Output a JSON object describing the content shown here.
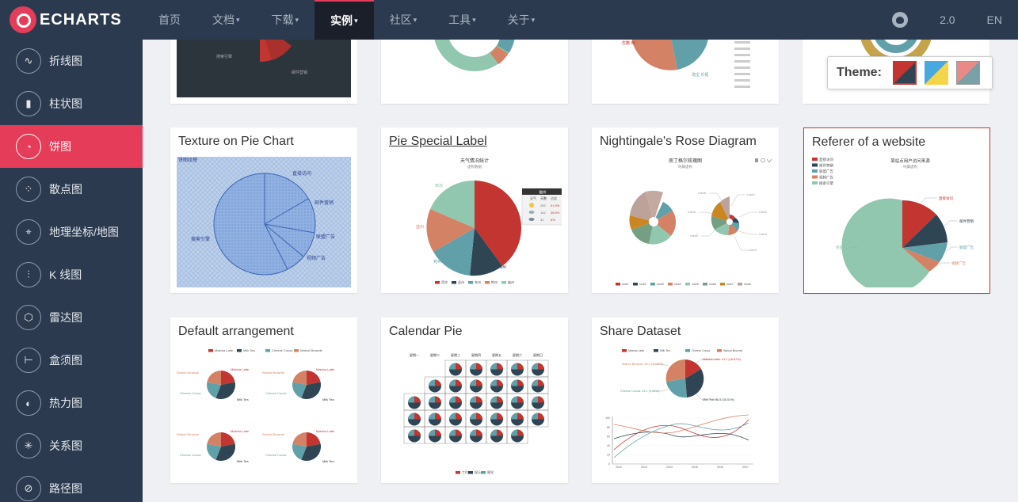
{
  "brand": {
    "name": "ECHARTS"
  },
  "nav": {
    "items": [
      {
        "label": "首页",
        "caret": false,
        "active": false
      },
      {
        "label": "文档",
        "caret": true,
        "active": false
      },
      {
        "label": "下载",
        "caret": true,
        "active": false
      },
      {
        "label": "实例",
        "caret": true,
        "active": true
      },
      {
        "label": "社区",
        "caret": true,
        "active": false
      },
      {
        "label": "工具",
        "caret": true,
        "active": false
      },
      {
        "label": "关于",
        "caret": true,
        "active": false
      }
    ],
    "version": "2.0",
    "language": "EN",
    "github_icon": "github-icon"
  },
  "sidebar": {
    "items": [
      {
        "label": "折线图",
        "icon": "line-chart-icon",
        "glyph": "∿"
      },
      {
        "label": "柱状图",
        "icon": "bar-chart-icon",
        "glyph": "▮"
      },
      {
        "label": "饼图",
        "icon": "pie-chart-icon",
        "glyph": "◔",
        "active": true
      },
      {
        "label": "散点图",
        "icon": "scatter-chart-icon",
        "glyph": "⁘"
      },
      {
        "label": "地理坐标/地图",
        "icon": "map-icon",
        "glyph": "⌖"
      },
      {
        "label": "K 线图",
        "icon": "candlestick-icon",
        "glyph": "⫶"
      },
      {
        "label": "雷达图",
        "icon": "radar-icon",
        "glyph": "⬡"
      },
      {
        "label": "盒须图",
        "icon": "boxplot-icon",
        "glyph": "⊢"
      },
      {
        "label": "热力图",
        "icon": "heatmap-icon",
        "glyph": "◐"
      },
      {
        "label": "关系图",
        "icon": "graph-icon",
        "glyph": "✳"
      },
      {
        "label": "路径图",
        "icon": "path-icon",
        "glyph": "⊘"
      }
    ]
  },
  "theme": {
    "label": "Theme:",
    "colors": [
      "#c23531",
      "#2f4554",
      "#f5d547",
      "#4aa8e0",
      "#e88a87",
      "#7aa0a8"
    ]
  },
  "cards": [
    {
      "title": "Texture on Pie Chart",
      "link": false,
      "selected": false
    },
    {
      "title": "Pie Special Label",
      "link": true,
      "selected": false
    },
    {
      "title": "Nightingale's Rose Diagram",
      "link": false,
      "selected": false
    },
    {
      "title": "Referer of a website",
      "link": false,
      "selected": true
    },
    {
      "title": "Default arrangement",
      "link": false,
      "selected": false
    },
    {
      "title": "Calendar Pie",
      "link": false,
      "selected": false
    },
    {
      "title": "Share Dataset",
      "link": false,
      "selected": false
    }
  ],
  "thumbs": {
    "texture": {
      "title": "饼图纹理",
      "labels": [
        "直接访问",
        "邮件营销",
        "联盟广告",
        "视频广告",
        "搜索引擎"
      ]
    },
    "special": {
      "title": "天气情况统计",
      "subtitle": "虚构数据",
      "labels": [
        "西凉",
        "益州",
        "兖州",
        "荆州",
        "幽州"
      ],
      "legend": [
        "西凉",
        "益州",
        "兖州",
        "荆州",
        "幽州"
      ],
      "table": {
        "header": "幽州",
        "cols": [
          "天气",
          "天数",
          "占比"
        ],
        "rows": [
          [
            "",
            "202",
            "51.9%"
          ],
          [
            "",
            "142",
            "36.5%"
          ],
          [
            "",
            "31",
            "8%"
          ]
        ]
      }
    },
    "rose": {
      "title": "南丁格尔玫瑰图",
      "subtitle": "纯属虚构",
      "legend": [
        "rose1",
        "rose2",
        "rose3",
        "rose4",
        "rose5",
        "rose6",
        "rose7",
        "rose8"
      ]
    },
    "referer": {
      "title": "某站点用户访问来源",
      "subtitle": "纯属虚构",
      "legend": [
        "直接访问",
        "邮件营销",
        "联盟广告",
        "视频广告",
        "搜索引擎"
      ],
      "labels": [
        "直接访问",
        "邮件营销",
        "联盟广告",
        "视频广告",
        "搜索引擎"
      ]
    },
    "default": {
      "legend": [
        "Matcha Latte",
        "Milk Tea",
        "Cheese Cocoa",
        "Walnut Brownie"
      ]
    },
    "calendar": {
      "days": [
        "星期一",
        "星期二",
        "星期三",
        "星期四",
        "星期五",
        "星期六",
        "星期日"
      ],
      "legend": [
        "工作",
        "娱乐",
        "睡觉"
      ]
    },
    "dataset": {
      "legend": [
        "Matcha Latte",
        "Milk Tea",
        "Cheese Cocoa",
        "Walnut Brownie"
      ],
      "labels": [
        "Walnut Brownie: 50.2 (20.60%)",
        "Matcha Latte: 41.1 (16.87%)",
        "Cheese Cocoa: 24.1 (9.89%)",
        "Milk Tea: 86.5 (35.51%)"
      ],
      "years": [
        "2012",
        "2013",
        "2014",
        "2015",
        "2016",
        "2017"
      ],
      "yticks": [
        "100",
        "80",
        "60",
        "40",
        "20",
        "0"
      ]
    }
  }
}
